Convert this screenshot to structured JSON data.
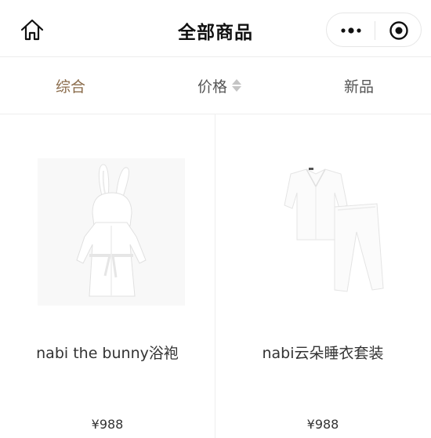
{
  "header": {
    "title": "全部商品",
    "home_icon": "home-icon",
    "more_icon": "more-dots-icon",
    "close_icon": "target-close-icon"
  },
  "sort_tabs": [
    {
      "label": "综合",
      "active": true
    },
    {
      "label": "价格",
      "active": false,
      "icon": "sort-up-down-icon"
    },
    {
      "label": "新品",
      "active": false
    }
  ],
  "colors": {
    "accent": "#8a6b4a",
    "text": "#333333",
    "divider": "#eeeeee"
  },
  "products": [
    {
      "name": "nabi the bunny浴袍",
      "price": "¥988",
      "image_icon": "bunny-robe-image"
    },
    {
      "name": "nabi云朵睡衣套装",
      "price": "¥988",
      "image_icon": "pajama-set-image"
    }
  ]
}
